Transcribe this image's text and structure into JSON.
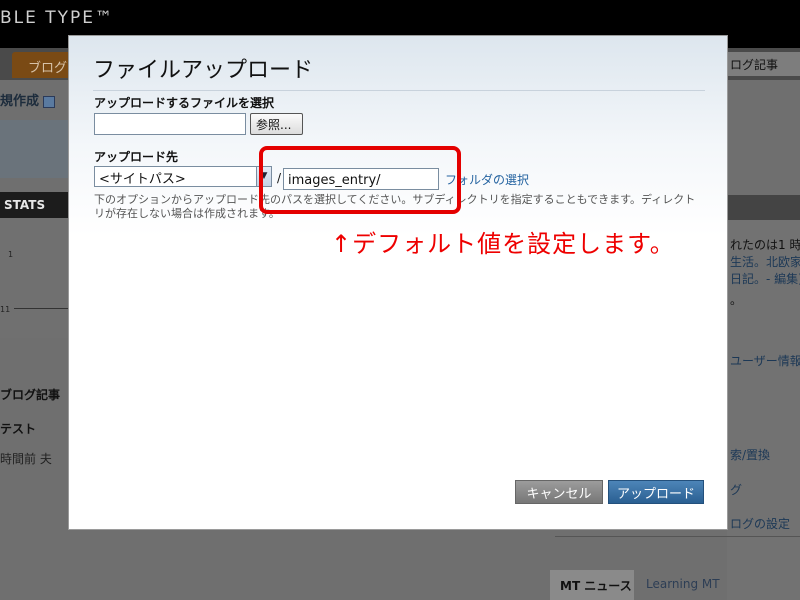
{
  "background": {
    "logo": "BLE TYPE™",
    "blog_tab": "ブログ",
    "right_tab": "ログ記事",
    "create_label": "規作成",
    "stats_label": "STATS",
    "stats_tick_1": "1",
    "stats_tick_2": "11",
    "blog_entries_label": "ブログ記事",
    "entry_title": "テスト",
    "entry_time": "時間前 夫",
    "right_panel": {
      "line1": "れたのは1 時",
      "line2": "生活。北欧家",
      "line3": "日記。- 編集)",
      "line4": "。",
      "line5": "ユーザー情報",
      "line6": "索/置換",
      "line7": "グ",
      "line8": "ログの設定"
    },
    "news_tab": "MT ニュース",
    "learning_tab": "Learning MT"
  },
  "dialog": {
    "title": "ファイルアップロード",
    "select_file_label": "アップロードするファイルを選択",
    "browse_button": "参照...",
    "destination_label": "アップロード先",
    "site_path_option": "<サイトパス>",
    "path_separator": "/",
    "path_value": "images_entry/",
    "folder_select_link": "フォルダの選択",
    "help_text": "下のオプションからアップロード先のパスを選択してください。サブディレクトリを指定することもできます。ディレクトリが存在しない場合は作成されます。",
    "cancel_button": "キャンセル",
    "upload_button": "アップロード"
  },
  "annotation": {
    "text": "↑デフォルト値を設定します。",
    "color": "#ee0000"
  }
}
